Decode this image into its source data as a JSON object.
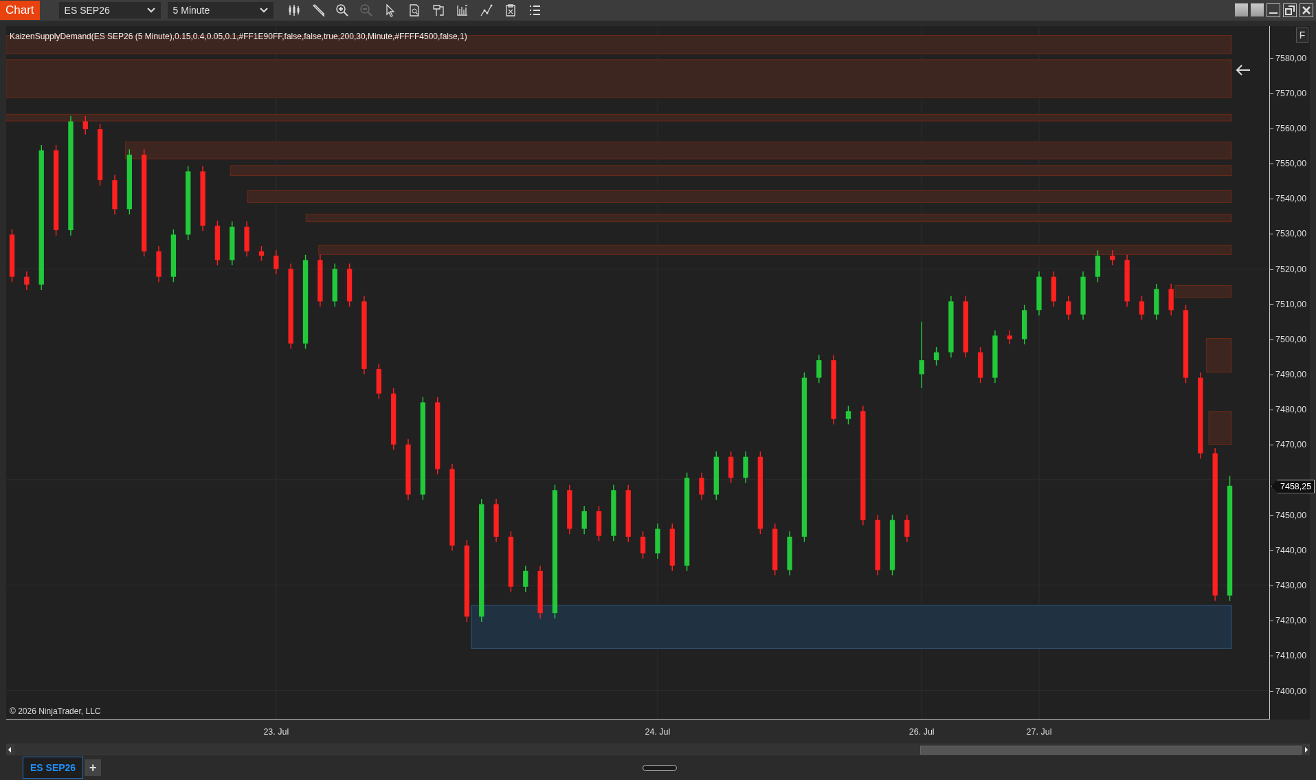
{
  "toolbar": {
    "app_tab": "Chart",
    "instrument": "ES SEP26",
    "interval": "5 Minute"
  },
  "indicator_label": "KaizenSupplyDemand(ES SEP26 (5 Minute),0.15,0.4,0.05,0.1,#FF1E90FF,false,false,true,200,30,Minute,#FFFF4500,false,1)",
  "panel_button": "F",
  "chart_data": {
    "type": "candlestick",
    "categories": [
      null,
      null,
      null,
      null,
      null,
      null,
      null,
      null,
      null,
      null,
      null,
      null,
      null,
      null,
      null,
      null,
      null,
      null,
      "23. Jul",
      null,
      null,
      null,
      null,
      null,
      null,
      null,
      null,
      null,
      null,
      null,
      null,
      null,
      null,
      null,
      null,
      null,
      null,
      null,
      null,
      null,
      null,
      null,
      null,
      null,
      "24. Jul",
      null,
      null,
      null,
      null,
      null,
      null,
      null,
      null,
      null,
      null,
      null,
      null,
      null,
      null,
      null,
      null,
      null,
      "26. Jul",
      null,
      null,
      null,
      null,
      null,
      null,
      null,
      "27. Jul",
      null,
      null,
      null,
      null,
      null,
      null,
      null,
      null,
      null,
      null,
      null,
      null,
      null
    ],
    "ohlc": [
      [
        7529.75,
        7531.25,
        7516.25,
        7517.75
      ],
      [
        7517.75,
        7519.25,
        7514,
        7515.5
      ],
      [
        7515.5,
        7555.25,
        7514,
        7553.75
      ],
      [
        7553.75,
        7555.25,
        7529.5,
        7531
      ],
      [
        7531,
        7563.5,
        7529.5,
        7562
      ],
      [
        7562,
        7563.5,
        7558.25,
        7559.75
      ],
      [
        7559.75,
        7561.25,
        7543.75,
        7545.25
      ],
      [
        7545.25,
        7546.75,
        7535.5,
        7537
      ],
      [
        7537,
        7554,
        7535.5,
        7552.5
      ],
      [
        7552.5,
        7554,
        7523.5,
        7525
      ],
      [
        7525,
        7526.5,
        7516.25,
        7517.75
      ],
      [
        7517.75,
        7531.25,
        7516.25,
        7529.75
      ],
      [
        7529.75,
        7549.25,
        7528.25,
        7547.75
      ],
      [
        7547.75,
        7549.25,
        7530.75,
        7532.25
      ],
      [
        7532.25,
        7533.75,
        7521,
        7522.5
      ],
      [
        7522.5,
        7533.5,
        7521,
        7532
      ],
      [
        7532,
        7533.5,
        7523.5,
        7525
      ],
      [
        7525,
        7526.5,
        7522.25,
        7523.75
      ],
      [
        7523.75,
        7525.25,
        7518.5,
        7520
      ],
      [
        7520,
        7521.5,
        7497.25,
        7498.75
      ],
      [
        7498.75,
        7524,
        7497.25,
        7522.5
      ],
      [
        7522.5,
        7524,
        7509.25,
        7510.75
      ],
      [
        7510.75,
        7521.5,
        7509.25,
        7520
      ],
      [
        7520,
        7521.5,
        7509.25,
        7510.75
      ],
      [
        7510.75,
        7512.25,
        7490,
        7491.5
      ],
      [
        7491.5,
        7493,
        7483,
        7484.5
      ],
      [
        7484.5,
        7486,
        7468.5,
        7470
      ],
      [
        7470,
        7471.5,
        7454.25,
        7455.75
      ],
      [
        7455.75,
        7483.5,
        7454.25,
        7482
      ],
      [
        7482,
        7483.5,
        7461.5,
        7463
      ],
      [
        7463,
        7464.5,
        7439.75,
        7441.25
      ],
      [
        7441.25,
        7442.75,
        7419.5,
        7421
      ],
      [
        7421,
        7454.5,
        7419.5,
        7453
      ],
      [
        7453,
        7454.5,
        7442.25,
        7443.75
      ],
      [
        7443.75,
        7445.25,
        7428,
        7429.5
      ],
      [
        7429.5,
        7435.5,
        7428,
        7434
      ],
      [
        7434,
        7435.5,
        7420.5,
        7422
      ],
      [
        7422,
        7458.5,
        7420.5,
        7457
      ],
      [
        7457,
        7458.5,
        7444.5,
        7446
      ],
      [
        7446,
        7452.5,
        7444.5,
        7451
      ],
      [
        7451,
        7452.5,
        7442.5,
        7444
      ],
      [
        7444,
        7458.5,
        7442.5,
        7457
      ],
      [
        7457,
        7458.5,
        7442.25,
        7443.75
      ],
      [
        7443.75,
        7445.25,
        7437.5,
        7439
      ],
      [
        7439,
        7447.5,
        7437.5,
        7446
      ],
      [
        7446,
        7447.5,
        7434,
        7435.5
      ],
      [
        7435.5,
        7462,
        7434,
        7460.5
      ],
      [
        7460.5,
        7462,
        7454.25,
        7455.75
      ],
      [
        7455.75,
        7468,
        7454.25,
        7466.5
      ],
      [
        7466.5,
        7468,
        7459,
        7460.5
      ],
      [
        7460.5,
        7468,
        7459,
        7466.5
      ],
      [
        7466.5,
        7468,
        7444.5,
        7446
      ],
      [
        7446,
        7447.5,
        7432.75,
        7434.25
      ],
      [
        7434.25,
        7445.25,
        7432.75,
        7443.75
      ],
      [
        7443.75,
        7490.5,
        7442.25,
        7489
      ],
      [
        7489,
        7495.5,
        7487.5,
        7494
      ],
      [
        7494,
        7495.5,
        7475.75,
        7477.25
      ],
      [
        7477.25,
        7481,
        7475.75,
        7479.5
      ],
      [
        7479.5,
        7481,
        7447,
        7448.5
      ],
      [
        7448.5,
        7450,
        7432.75,
        7434.25
      ],
      [
        7434.25,
        7450,
        7432.75,
        7448.5
      ],
      [
        7448.5,
        7450,
        7442.25,
        7443.75
      ],
      [
        7490,
        7505,
        7486,
        7494
      ],
      [
        7494,
        7497.75,
        7492.5,
        7496.25
      ],
      [
        7496.25,
        7512.25,
        7494.75,
        7510.75
      ],
      [
        7510.75,
        7512.25,
        7494.75,
        7496.25
      ],
      [
        7496.25,
        7497.75,
        7487.5,
        7489
      ],
      [
        7489,
        7502.5,
        7487.5,
        7501
      ],
      [
        7501,
        7502.5,
        7498.5,
        7500
      ],
      [
        7500,
        7509.75,
        7498.5,
        7508.25
      ],
      [
        7508.25,
        7519.25,
        7506.75,
        7517.75
      ],
      [
        7517.75,
        7519.25,
        7509.25,
        7510.75
      ],
      [
        7510.75,
        7512.25,
        7505.5,
        7507
      ],
      [
        7507,
        7519.25,
        7505.5,
        7517.75
      ],
      [
        7517.75,
        7525.25,
        7516.25,
        7523.75
      ],
      [
        7523.75,
        7525.25,
        7521,
        7522.5
      ],
      [
        7522.5,
        7524,
        7509.25,
        7510.75
      ],
      [
        7510.75,
        7512.25,
        7505.5,
        7507
      ],
      [
        7507,
        7515.75,
        7505.5,
        7514.25
      ],
      [
        7514.25,
        7515.75,
        7506.75,
        7508.25
      ],
      [
        7508.25,
        7509.75,
        7487.5,
        7489
      ],
      [
        7489,
        7490.5,
        7466,
        7467.5
      ],
      [
        7467.5,
        7469,
        7425.5,
        7427
      ],
      [
        7427,
        7461,
        7425.5,
        7458.25
      ]
    ],
    "grid": true,
    "ylim": [
      7391.9,
      7589.1
    ],
    "yticks": [
      {
        "value": 7580,
        "label": "7580,00"
      },
      {
        "value": 7570,
        "label": "7570,00"
      },
      {
        "value": 7560,
        "label": "7560,00"
      },
      {
        "value": 7550,
        "label": "7550,00"
      },
      {
        "value": 7540,
        "label": "7540,00"
      },
      {
        "value": 7530,
        "label": "7530,00"
      },
      {
        "value": 7520,
        "label": "7520,00"
      },
      {
        "value": 7510,
        "label": "7510,00"
      },
      {
        "value": 7500,
        "label": "7500,00"
      },
      {
        "value": 7490,
        "label": "7490,00"
      },
      {
        "value": 7480,
        "label": "7480,00"
      },
      {
        "value": 7470,
        "label": "7470,00"
      },
      {
        "value": 7450,
        "label": "7450,00"
      },
      {
        "value": 7440,
        "label": "7440,00"
      },
      {
        "value": 7430,
        "label": "7430,00"
      },
      {
        "value": 7420,
        "label": "7420,00"
      },
      {
        "value": 7410,
        "label": "7410,00"
      },
      {
        "value": 7400,
        "label": "7400,00"
      }
    ]
  },
  "current_price": "7458,25",
  "copyright": "© 2026 NinjaTrader, LLC",
  "instrument_tabs": [
    {
      "label": "ES SEP26",
      "selected": true
    }
  ],
  "add_tab": "+"
}
